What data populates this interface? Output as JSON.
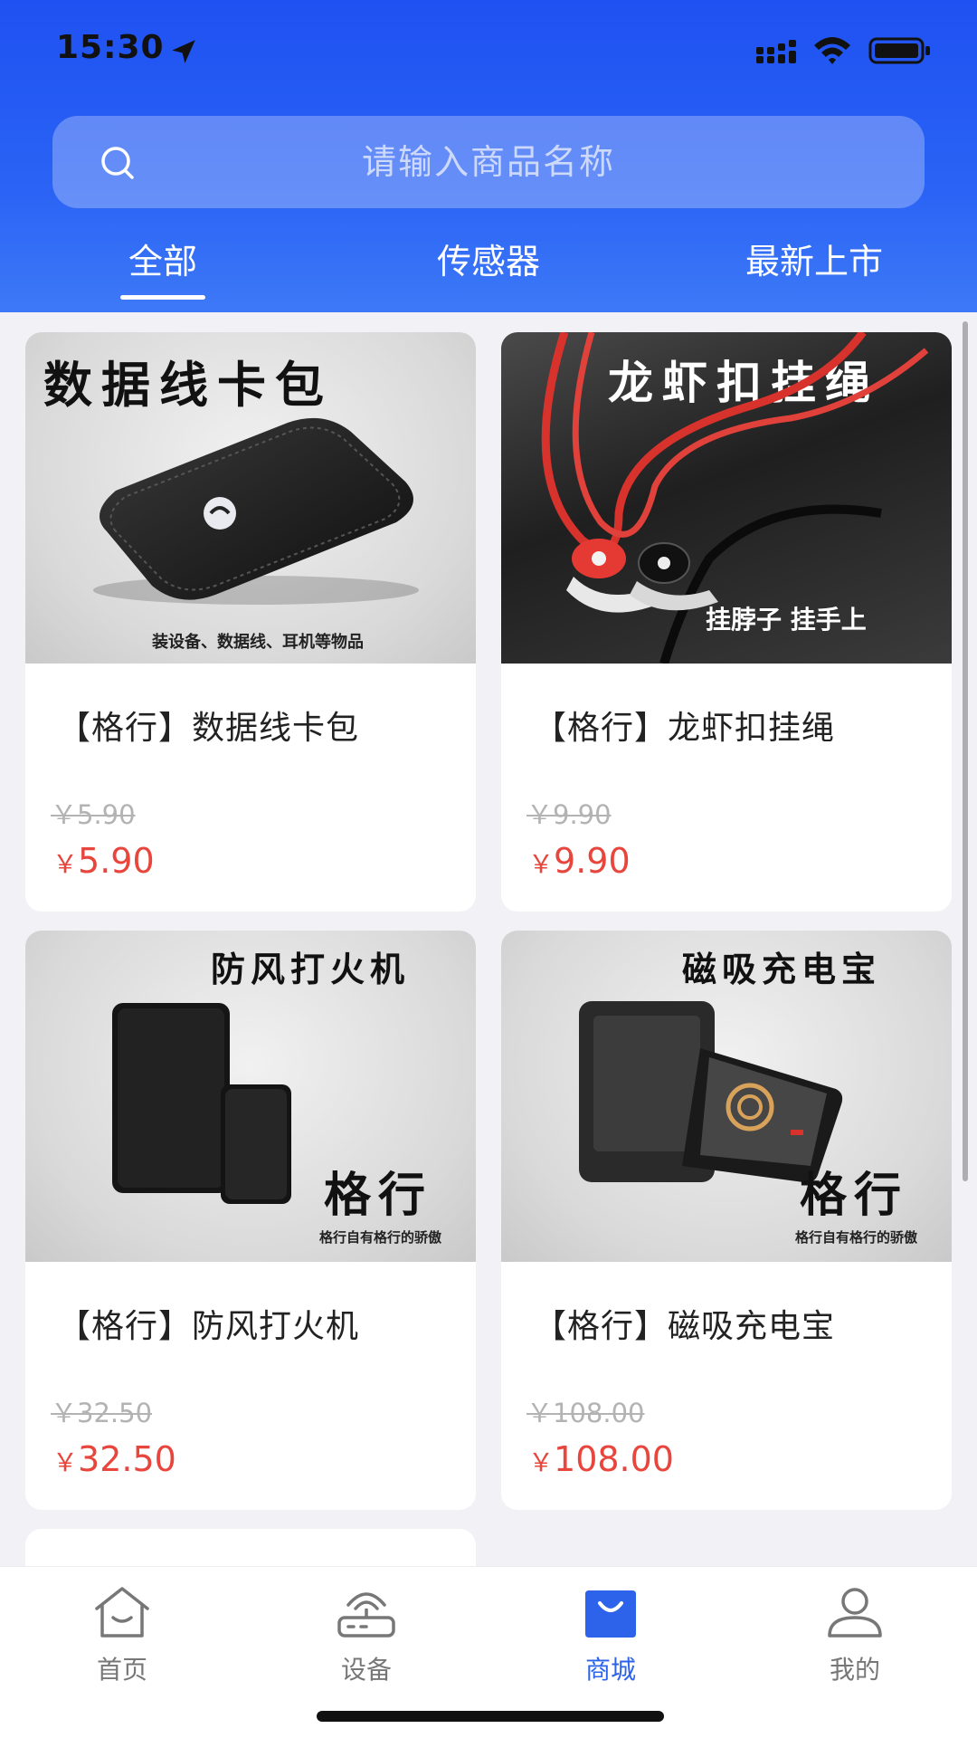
{
  "status_bar": {
    "time": "15:30"
  },
  "search": {
    "placeholder": "请输入商品名称"
  },
  "tabs": [
    {
      "label": "全部",
      "active": true
    },
    {
      "label": "传感器",
      "active": false
    },
    {
      "label": "最新上市",
      "active": false
    }
  ],
  "products": [
    {
      "image_title": "数据线卡包",
      "image_caption": "装设备、数据线、耳机等物品",
      "name": "【格行】数据线卡包",
      "original_price": "￥5.90",
      "currency": "￥",
      "price": "5.90"
    },
    {
      "image_title": "龙虾扣挂绳",
      "image_caption": "挂脖子  挂手上",
      "name": "【格行】龙虾扣挂绳",
      "original_price": "￥9.90",
      "currency": "￥",
      "price": "9.90"
    },
    {
      "image_title": "防风打火机",
      "image_brand": "格行",
      "image_caption": "格行自有格行的骄傲",
      "name": "【格行】防风打火机",
      "original_price": "￥32.50",
      "currency": "￥",
      "price": "32.50"
    },
    {
      "image_title": "磁吸充电宝",
      "image_brand": "格行",
      "image_caption": "格行自有格行的骄傲",
      "name": "【格行】磁吸充电宝",
      "original_price": "￥108.00",
      "currency": "￥",
      "price": "108.00"
    }
  ],
  "bottom_nav": [
    {
      "label": "首页",
      "icon": "home-icon",
      "active": false
    },
    {
      "label": "设备",
      "icon": "router-icon",
      "active": false
    },
    {
      "label": "商城",
      "icon": "shopping-bag-icon",
      "active": true
    },
    {
      "label": "我的",
      "icon": "user-icon",
      "active": false
    }
  ],
  "colors": {
    "header_gradient_top": "#1f51f2",
    "header_gradient_bottom": "#3d79f7",
    "price_red": "#e8453c",
    "active_blue": "#2d63ea",
    "background": "#f2f2f6"
  }
}
